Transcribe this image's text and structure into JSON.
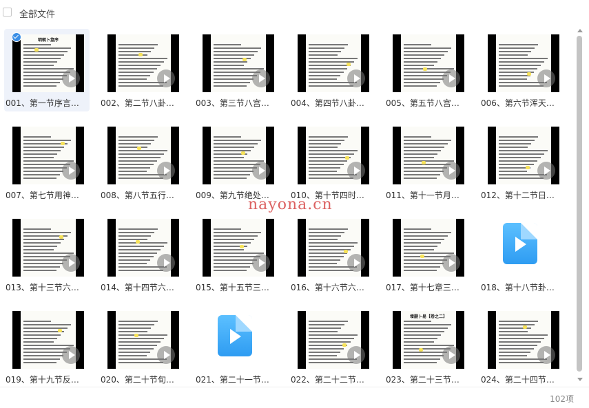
{
  "header": {
    "select_all_label": "全部文件"
  },
  "files": [
    {
      "name": "001、第一节序言…",
      "kind": "video",
      "selected": true,
      "cover": "明朝卜筮序"
    },
    {
      "name": "002、第二节八卦…",
      "kind": "video",
      "selected": false
    },
    {
      "name": "003、第三节八宫…",
      "kind": "video",
      "selected": false
    },
    {
      "name": "004、第四节八卦…",
      "kind": "video",
      "selected": false
    },
    {
      "name": "005、第五节八宫…",
      "kind": "video",
      "selected": false
    },
    {
      "name": "006、第六节浑天…",
      "kind": "video",
      "selected": false
    },
    {
      "name": "007、第七节用神…",
      "kind": "video",
      "selected": false
    },
    {
      "name": "008、第八节五行…",
      "kind": "video",
      "selected": false
    },
    {
      "name": "009、第九节绝处…",
      "kind": "video",
      "selected": false
    },
    {
      "name": "010、第十节四时…",
      "kind": "video",
      "selected": false
    },
    {
      "name": "011、第十一节月…",
      "kind": "video",
      "selected": false
    },
    {
      "name": "012、第十二节日…",
      "kind": "video",
      "selected": false
    },
    {
      "name": "013、第十三节六…",
      "kind": "video",
      "selected": false
    },
    {
      "name": "014、第十四节六…",
      "kind": "video",
      "selected": false
    },
    {
      "name": "015、第十五节三…",
      "kind": "video",
      "selected": false
    },
    {
      "name": "016、第十六节六…",
      "kind": "video",
      "selected": false
    },
    {
      "name": "017、第十七章三…",
      "kind": "video",
      "selected": false
    },
    {
      "name": "018、第十八节卦…",
      "kind": "video-icon",
      "selected": false
    },
    {
      "name": "019、第十九节反…",
      "kind": "video",
      "selected": false
    },
    {
      "name": "020、第二十节旬…",
      "kind": "video",
      "selected": false
    },
    {
      "name": "021、第二十一节…",
      "kind": "video-icon",
      "selected": false
    },
    {
      "name": "022、第二十二节…",
      "kind": "video",
      "selected": false
    },
    {
      "name": "023、第二十三节…",
      "kind": "video",
      "selected": false,
      "cover": "增删卜易【卷之二】"
    },
    {
      "name": "024、第二十四节…",
      "kind": "video",
      "selected": false
    }
  ],
  "footer": {
    "count": "102项"
  },
  "watermark": "nayona.cn",
  "colors": {
    "accent": "#3a8ee6",
    "selected_bg": "#eef2fa",
    "watermark": "#d64545"
  }
}
